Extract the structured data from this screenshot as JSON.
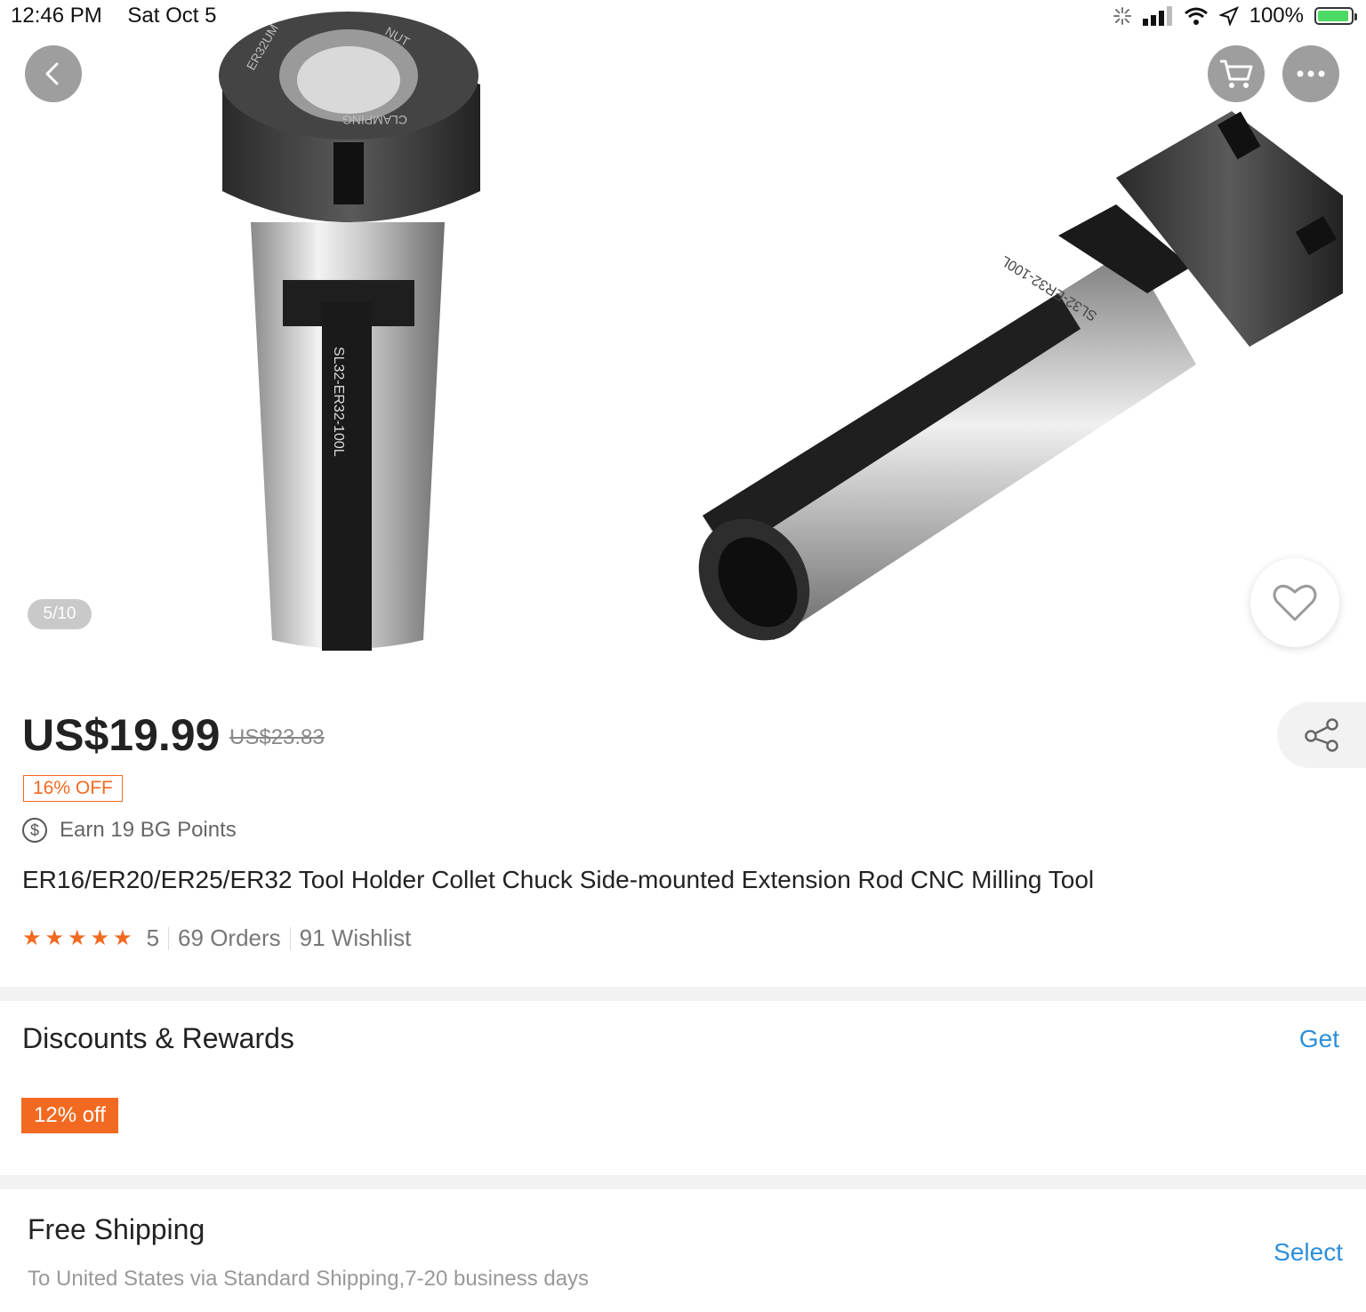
{
  "status_bar": {
    "time": "12:46 PM",
    "date": "Sat Oct 5",
    "battery": "100%"
  },
  "gallery": {
    "counter": "5/10",
    "image_text": {
      "nut_top": "ER32UM",
      "nut_side": "NUT",
      "nut_clamping": "CLAMPING",
      "shank_left": "SL32-ER32-100L",
      "shank_right": "SL32-ER32-100L"
    }
  },
  "product": {
    "price": "US$19.99",
    "original_price": "US$23.83",
    "discount_badge": "16% OFF",
    "points": "Earn 19 BG Points",
    "points_icon_glyph": "$",
    "title": "ER16/ER20/ER25/ER32 Tool Holder Collet Chuck Side-mounted Extension Rod CNC Milling Tool",
    "rating_value": 5,
    "rating_stars": "★★★★★",
    "rating_text": "5",
    "orders": "69 Orders",
    "wishlist": "91 Wishlist"
  },
  "discounts": {
    "title": "Discounts & Rewards",
    "action": "Get",
    "coupon": "12% off"
  },
  "shipping": {
    "title": "Free Shipping",
    "subtitle": "To United States via Standard Shipping,7-20 business days",
    "action": "Select"
  },
  "colors": {
    "accent": "#f26a21",
    "link": "#2d8fd9",
    "button_gray": "#9e9e9e"
  },
  "icons": [
    "back-icon",
    "cart-icon",
    "more-icon",
    "heart-icon",
    "share-icon",
    "coin-icon",
    "star-icon",
    "battery-icon",
    "wifi-icon",
    "signal-icon",
    "location-icon"
  ]
}
